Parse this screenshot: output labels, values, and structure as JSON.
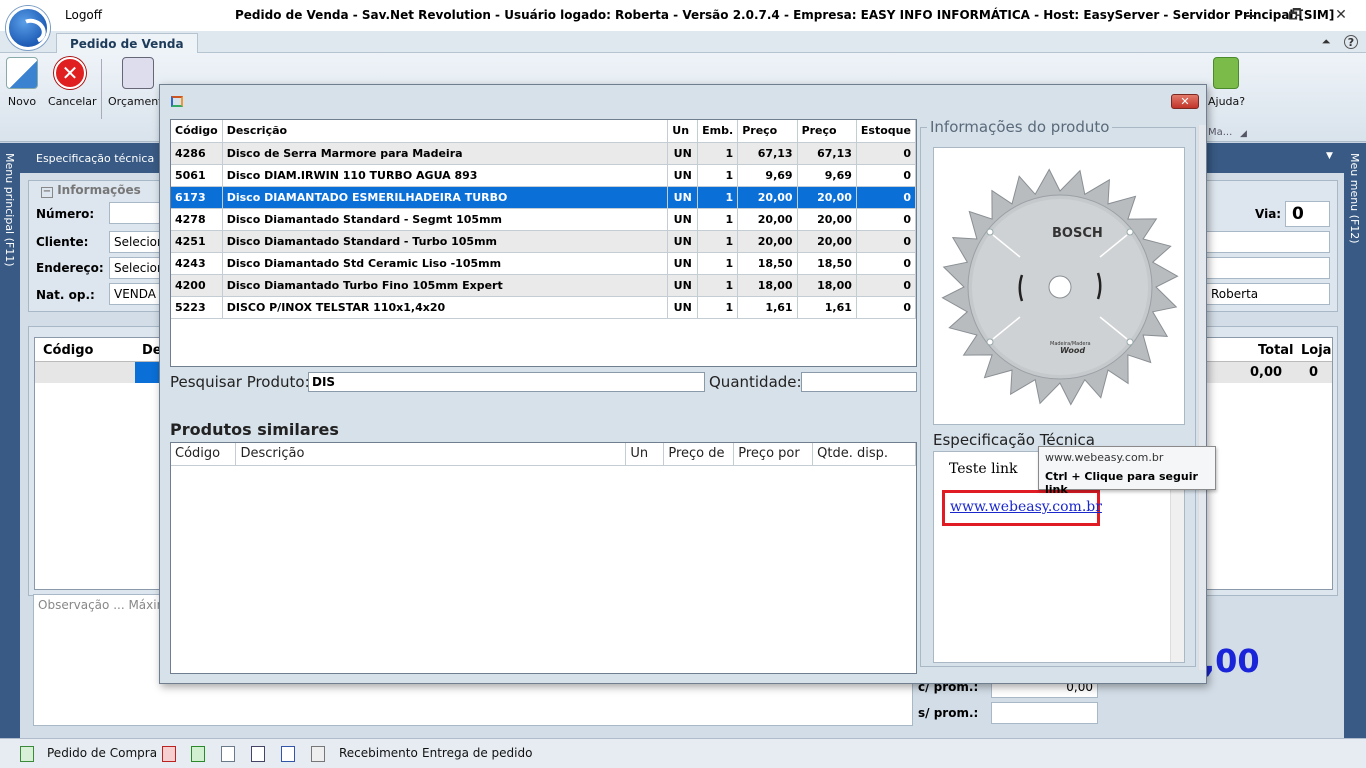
{
  "window": {
    "logoff": "Logoff",
    "title": "Pedido de Venda - Sav.Net Revolution - Usuário logado: Roberta - Versão 2.0.7.4 - Empresa: EASY INFO INFORMÁTICA - Host: EasyServer - Servidor Principal:[SIM]",
    "minimize": "🗕",
    "restore": "🗗",
    "close": "✕"
  },
  "ribbon": {
    "tab": "Pedido de Venda",
    "collapse": "⏶",
    "help_q": "?",
    "buttons": [
      {
        "label": "Novo",
        "color": "#3b82d0"
      },
      {
        "label": "Cancelar",
        "color": "#e02020"
      },
      {
        "label": "Orçament",
        "color": "#556677"
      }
    ],
    "help_label": "Ajuda?",
    "group_label": "Ma..."
  },
  "side": {
    "left_label": "Menu principal (F11)",
    "right_label": "Meu menu (F12)"
  },
  "background": {
    "spec_header": "Especificação técnica",
    "spec_header_arrow": "▼",
    "info_legend": "Informações",
    "labels": {
      "numero": "Número:",
      "cliente": "Cliente:",
      "endereco": "Endereço:",
      "natop": "Nat. op.:",
      "via": "Via:"
    },
    "cliente_value": "Selecion",
    "endereco_value": "Selecion",
    "natop_value": "VENDA S",
    "via_value": "0",
    "user_value": "Roberta",
    "grid_headers": {
      "codigo": "Código",
      "de": "De",
      "total": "Total",
      "loja": "Loja"
    },
    "total_value": "0,00",
    "loja_value": "0",
    "observacao_placeholder": "Observação ... Máxim",
    "cprom_label": "c/ prom.:",
    "cprom_value": "0,00",
    "sprom_label": "s/ prom.:",
    "big_total": ",00"
  },
  "statusbar": {
    "pedido_compra": "Pedido de Compra",
    "recebimento": "Recebimento",
    "entrega": "Entrega de pedido"
  },
  "modal": {
    "close_label": "✕",
    "grid": {
      "headers": [
        "Código",
        "Descrição",
        "Un",
        "Emb.",
        "Preço",
        "Preço",
        "Estoque"
      ],
      "rows": [
        [
          "4286",
          "Disco de Serra Marmore para Madeira",
          "UN",
          "1",
          "67,13",
          "67,13",
          "0"
        ],
        [
          "5061",
          "Disco DIAM.IRWIN 110 TURBO AGUA 893",
          "UN",
          "1",
          "9,69",
          "9,69",
          "0"
        ],
        [
          "6173",
          "Disco DIAMANTADO ESMERILHADEIRA TURBO",
          "UN",
          "1",
          "20,00",
          "20,00",
          "0"
        ],
        [
          "4278",
          "Disco Diamantado Standard - Segmt 105mm",
          "UN",
          "1",
          "20,00",
          "20,00",
          "0"
        ],
        [
          "4251",
          "Disco Diamantado Standard - Turbo 105mm",
          "UN",
          "1",
          "20,00",
          "20,00",
          "0"
        ],
        [
          "4243",
          "Disco Diamantado Std Ceramic Liso -105mm",
          "UN",
          "1",
          "18,50",
          "18,50",
          "0"
        ],
        [
          "4200",
          "Disco Diamantado Turbo Fino 105mm Expert",
          "UN",
          "1",
          "18,00",
          "18,00",
          "0"
        ],
        [
          "5223",
          "DISCO P/INOX TELSTAR 110x1,4x20",
          "UN",
          "1",
          "1,61",
          "1,61",
          "0"
        ]
      ],
      "selected_index": 2
    },
    "search": {
      "label": "Pesquisar Produto:",
      "value": "DIS",
      "qty_label": "Quantidade:",
      "qty_value": ""
    },
    "similar": {
      "title": "Produtos similares",
      "headers": [
        "Código",
        "Descrição",
        "Un",
        "Preço de",
        "Preço por",
        "Qtde. disp."
      ]
    },
    "info": {
      "title": "Informações do produto",
      "brand": "BOSCH",
      "small_text": "Madeira/Madera",
      "wood_text": "Wood",
      "spec_title": "Especificação Técnica",
      "spec_text": "Teste link",
      "link": "www.webeasy.com.br"
    },
    "tooltip": {
      "url": "www.webeasy.com.br",
      "hint": "Ctrl + Clique para seguir link"
    }
  }
}
